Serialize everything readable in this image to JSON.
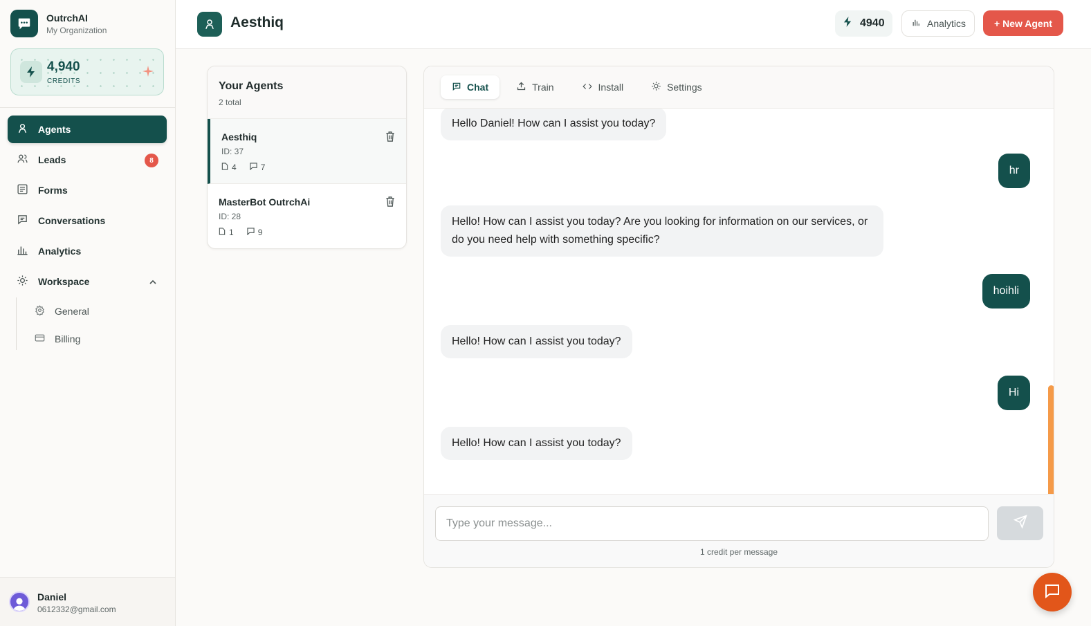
{
  "brand": {
    "name": "OutrchAI",
    "org": "My Organization"
  },
  "credits_card": {
    "value": "4,940",
    "label": "CREDITS"
  },
  "nav": {
    "agents": "Agents",
    "leads": "Leads",
    "leads_badge": "8",
    "forms": "Forms",
    "conversations": "Conversations",
    "analytics": "Analytics",
    "workspace": "Workspace",
    "general": "General",
    "billing": "Billing"
  },
  "user": {
    "name": "Daniel",
    "email": "0612332@gmail.com"
  },
  "header": {
    "title": "Aesthiq",
    "credits": "4940",
    "analytics_label": "Analytics",
    "new_agent_label": "+ New Agent"
  },
  "agents_panel": {
    "title": "Your Agents",
    "count": "2 total",
    "items": [
      {
        "name": "Aesthiq",
        "id": "ID: 37",
        "docs": "4",
        "chats": "7"
      },
      {
        "name": "MasterBot OutrchAi",
        "id": "ID: 28",
        "docs": "1",
        "chats": "9"
      }
    ]
  },
  "tabs": [
    "Chat",
    "Train",
    "Install",
    "Settings"
  ],
  "messages": [
    {
      "role": "bot",
      "text": "Hello Daniel! How can I assist you today?"
    },
    {
      "role": "user",
      "text": "hr"
    },
    {
      "role": "bot",
      "text": "Hello! How can I assist you today? Are you looking for information on our services, or do you need help with something specific?"
    },
    {
      "role": "user",
      "text": "hoihli"
    },
    {
      "role": "bot",
      "text": "Hello! How can I assist you today?"
    },
    {
      "role": "user",
      "text": "Hi"
    },
    {
      "role": "bot",
      "text": "Hello! How can I assist you today?"
    }
  ],
  "composer": {
    "placeholder": "Type your message...",
    "hint": "1 credit per message"
  },
  "colors": {
    "brand": "#14504c",
    "accent": "#e4574a",
    "scrollbar": "#f59a48",
    "fab": "#e2561a"
  }
}
